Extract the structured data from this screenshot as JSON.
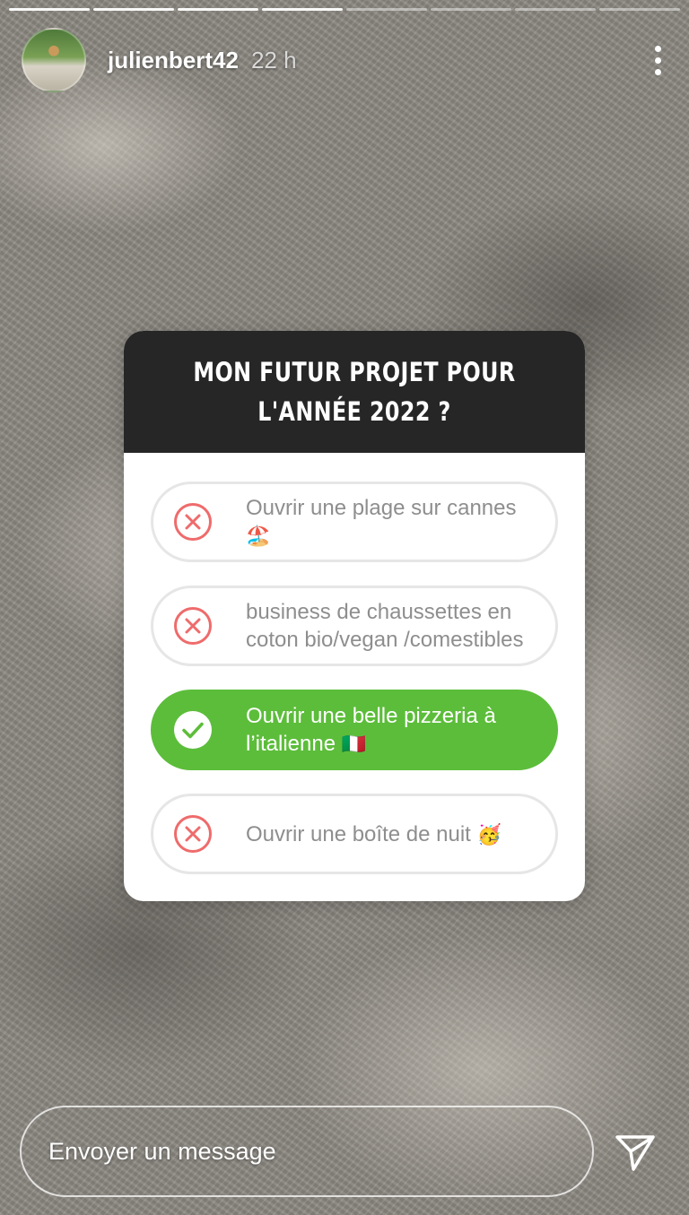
{
  "story": {
    "progress": {
      "total_segments": 8,
      "completed_segments": 4
    },
    "user": {
      "username": "julienbert42",
      "time": "22 h"
    },
    "more_icon": "more-vertical-icon"
  },
  "poll": {
    "question": "MON FUTUR PROJET POUR L'ANNÉE 2022 ?",
    "options": [
      {
        "text": "Ouvrir une plage sur cannes",
        "emoji": "🏖️",
        "status": "incorrect",
        "icon": "x-circle-icon"
      },
      {
        "text": "business de chaussettes en coton bio/vegan /comestibles",
        "emoji": "",
        "status": "incorrect",
        "icon": "x-circle-icon"
      },
      {
        "text": "Ouvrir une belle pizzeria à l’italienne",
        "emoji": "🇮🇹",
        "status": "correct",
        "icon": "check-circle-icon"
      },
      {
        "text": "Ouvrir une boîte de nuit",
        "emoji": "🥳",
        "status": "incorrect",
        "icon": "x-circle-icon"
      }
    ],
    "colors": {
      "correct": "#5cbd3a",
      "incorrect_mark": "#ef6b6b",
      "header_bg": "#262626"
    }
  },
  "reply": {
    "placeholder": "Envoyer un message",
    "send_icon": "send-icon"
  }
}
